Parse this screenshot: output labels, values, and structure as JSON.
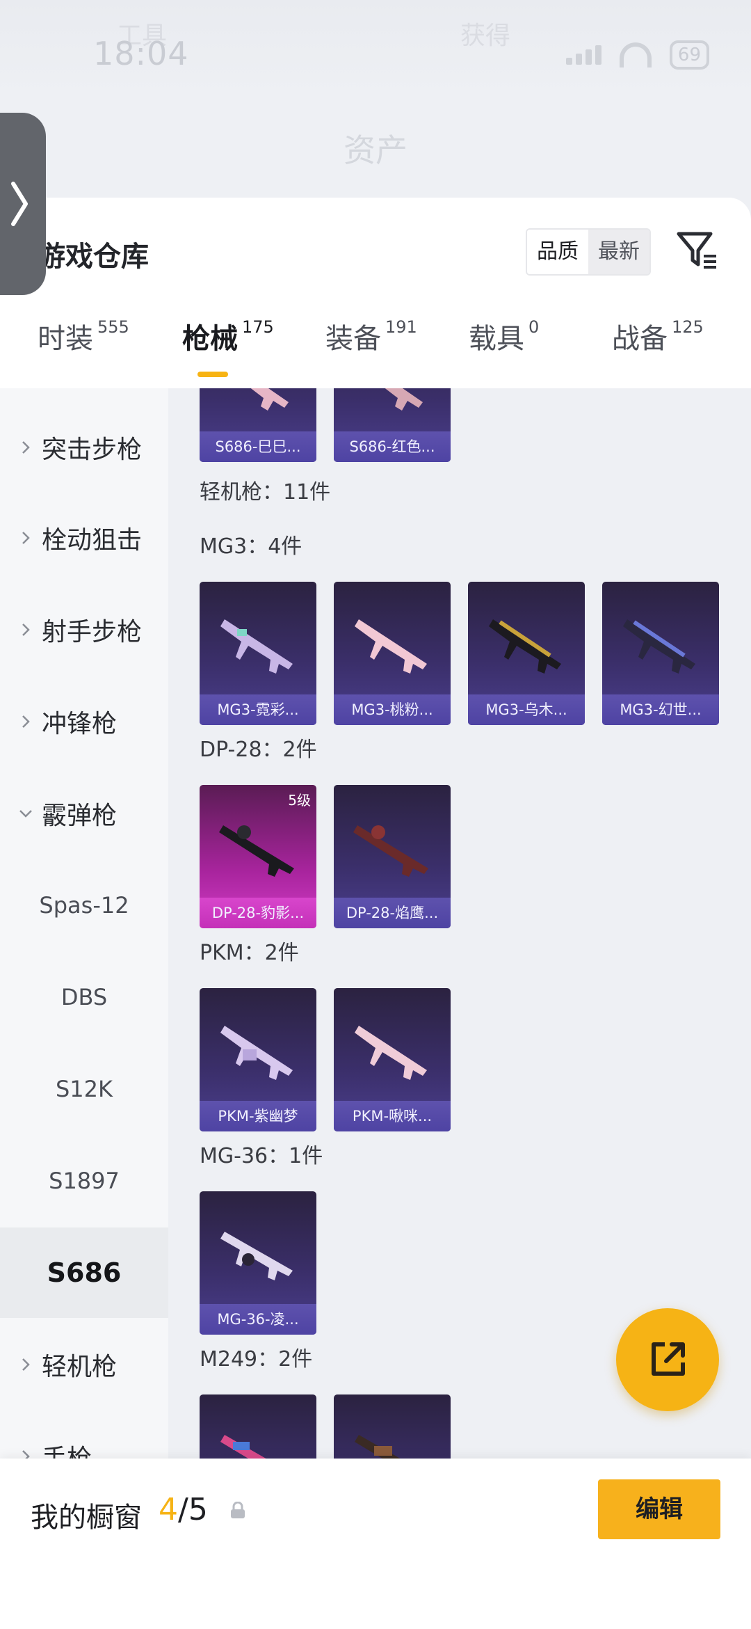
{
  "status": {
    "time": "18:04",
    "ghost_left": "工具",
    "ghost_right": "获得",
    "battery": "69"
  },
  "header": {
    "title": "资产"
  },
  "panel": {
    "title": "游戏仓库",
    "sort": {
      "quality": "品质",
      "newest": "最新"
    }
  },
  "tabs": [
    {
      "label": "时装",
      "count": "555"
    },
    {
      "label": "枪械",
      "count": "175"
    },
    {
      "label": "装备",
      "count": "191"
    },
    {
      "label": "载具",
      "count": "0"
    },
    {
      "label": "战备",
      "count": "125"
    }
  ],
  "categories": [
    {
      "label": "突击步枪"
    },
    {
      "label": "栓动狙击"
    },
    {
      "label": "射手步枪"
    },
    {
      "label": "冲锋枪"
    },
    {
      "label": "霰弹枪"
    },
    {
      "label": "Spas-12"
    },
    {
      "label": "DBS"
    },
    {
      "label": "S12K"
    },
    {
      "label": "S1897"
    },
    {
      "label": "S686"
    },
    {
      "label": "轻机枪"
    },
    {
      "label": "手枪"
    }
  ],
  "sections": {
    "top_cards": [
      "S686-巳巳...",
      "S686-红色..."
    ],
    "lmg_header": "轻机枪：11件",
    "mg3": {
      "title": "MG3：4件",
      "cards": [
        "MG3-霓彩...",
        "MG3-桃粉...",
        "MG3-乌木...",
        "MG3-幻世..."
      ]
    },
    "dp28": {
      "title": "DP-28：2件",
      "cards": [
        "DP-28-豹影...",
        "DP-28-焰鹰..."
      ],
      "level": "5级"
    },
    "pkm": {
      "title": "PKM：2件",
      "cards": [
        "PKM-紫幽梦",
        "PKM-啾咪..."
      ]
    },
    "mg36": {
      "title": "MG-36：1件",
      "cards": [
        "MG-36-凌..."
      ]
    },
    "m249": {
      "title": "M249：2件"
    }
  },
  "window": {
    "label": "我的橱窗",
    "current": "4",
    "total": "/5",
    "edit": "编辑"
  },
  "colors": {
    "accent": "#f6b315",
    "card_purple": "#4b3f8e",
    "card_rare": "#c430b8"
  }
}
